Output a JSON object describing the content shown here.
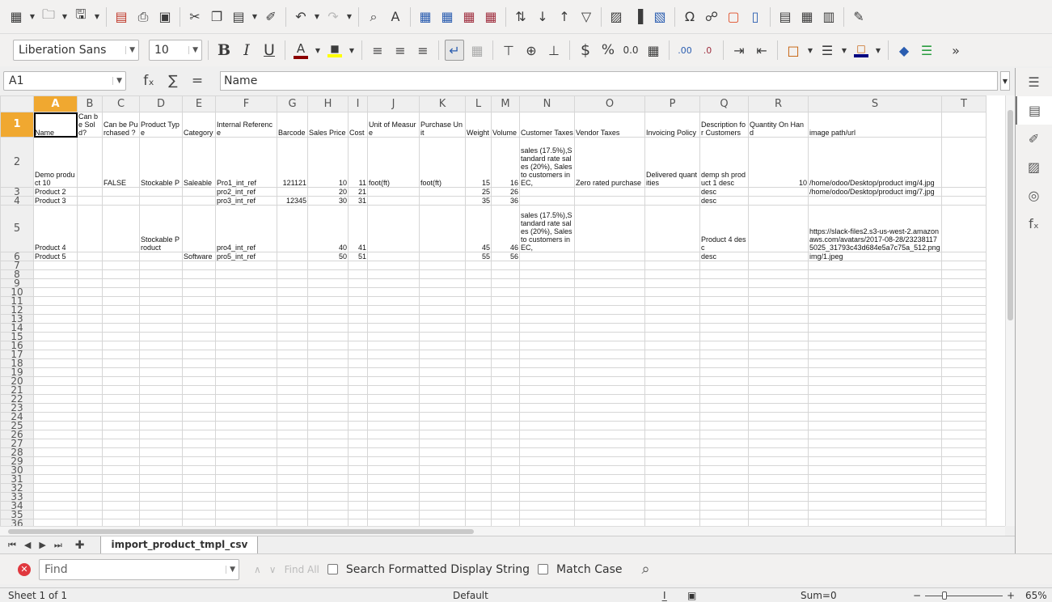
{
  "toolbar1": {
    "icons": [
      "new-spreadsheet-icon",
      "open-icon",
      "save-icon",
      "export-pdf-icon",
      "print-icon",
      "print-preview-icon",
      "cut-icon",
      "copy-icon",
      "paste-icon",
      "clone-formatting-icon",
      "undo-icon",
      "redo-icon",
      "find-replace-icon",
      "spelling-icon",
      "row-icon",
      "column-icon",
      "delete-row-icon",
      "delete-column-icon",
      "sort-ascending-icon",
      "sort-descending-icon",
      "sort-icon",
      "autofilter-icon",
      "insert-image-icon",
      "insert-chart-icon",
      "pivot-table-icon",
      "special-character-icon",
      "hyperlink-icon",
      "comment-icon",
      "header-footer-icon",
      "define-print-area-icon",
      "freeze-rows-icon",
      "split-window-icon",
      "show-draw-functions-icon"
    ]
  },
  "toolbar2": {
    "font_name": "Liberation Sans",
    "font_size": "10",
    "font_color": "#8b0000",
    "highlight_color": "#ffff00",
    "border_color": "#000080",
    "labels": {
      "bold": "B",
      "italic": "I",
      "underline": "U",
      "currency": "$",
      "percent": "%",
      "number": "0.0",
      "add_decimal": ".00",
      "del_decimal": ".0"
    }
  },
  "formula_bar": {
    "cell_ref": "A1",
    "content": "Name",
    "fx": "fₓ",
    "sum": "∑",
    "equals": "="
  },
  "columns": [
    "A",
    "B",
    "C",
    "D",
    "E",
    "F",
    "G",
    "H",
    "I",
    "J",
    "K",
    "L",
    "M",
    "N",
    "O",
    "P",
    "Q",
    "R",
    "S",
    "T"
  ],
  "rows": [
    [
      "Name",
      "Can be Sold?",
      "Can be Purchased ?",
      "Product Type",
      "Category",
      "Internal Reference",
      "Barcode",
      "Sales Price",
      "Cost",
      "Unit of Measure",
      "Purchase Unit",
      "Weight",
      "Volume",
      "Customer Taxes",
      "Vendor Taxes",
      "Invoicing Policy",
      "Description for Customers",
      "Quantity On Hand",
      "image path/url",
      ""
    ],
    [
      "Demo product 10",
      "",
      "FALSE",
      "Stockable P",
      "Saleable",
      "Pro1_int_ref",
      "121121",
      "10",
      "11",
      "foot(ft)",
      "foot(ft)",
      "15",
      "16",
      "sales (17.5%),Standard rate sales (20%), Sales to customers in EC,",
      "Zero rated purchase",
      "Delivered quantities",
      "demp sh product 1 desc",
      "10",
      "/home/odoo/Desktop/product img/4.jpg",
      ""
    ],
    [
      "Product 2",
      "",
      "",
      "",
      "",
      "pro2_int_ref",
      "",
      "20",
      "21",
      "",
      "",
      "25",
      "26",
      "",
      "",
      "",
      "desc",
      "",
      "/home/odoo/Desktop/product img/7.jpg",
      ""
    ],
    [
      "Product 3",
      "",
      "",
      "",
      "",
      "pro3_int_ref",
      "12345",
      "30",
      "31",
      "",
      "",
      "35",
      "36",
      "",
      "",
      "",
      "desc",
      "",
      "",
      ""
    ],
    [
      "Product 4",
      "",
      "",
      "Stockable Product",
      "",
      "pro4_int_ref",
      "",
      "40",
      "41",
      "",
      "",
      "45",
      "46",
      "sales (17.5%),Standard rate sales (20%), Sales to customers in EC,",
      "",
      "",
      "Product 4 desc",
      "",
      "https://slack-files2.s3-us-west-2.amazonaws.com/avatars/2017-08-28/232381175025_31793c43d684e5a7c75a_512.png",
      ""
    ],
    [
      "Product 5",
      "",
      "",
      "",
      "Software",
      "pro5_int_ref",
      "",
      "50",
      "51",
      "",
      "",
      "55",
      "56",
      "",
      "",
      "",
      "desc",
      "",
      "img/1.jpeg",
      ""
    ]
  ],
  "empty_rows": [
    "7",
    "8",
    "9",
    "10",
    "11",
    "12",
    "13",
    "14",
    "15",
    "16",
    "17",
    "18",
    "19",
    "20",
    "21",
    "22",
    "23",
    "24",
    "25",
    "26",
    "27",
    "28",
    "29",
    "30",
    "31",
    "32",
    "33",
    "34",
    "35",
    "36"
  ],
  "sheet_tab": "import_product_tmpl_csv",
  "find_bar": {
    "placeholder": "Find",
    "find_all": "Find All",
    "search_formatted": "Search Formatted Display String",
    "match_case": "Match Case"
  },
  "status": {
    "sheet": "Sheet 1 of 1",
    "style": "Default",
    "sum": "Sum=0",
    "zoom": "65%"
  }
}
